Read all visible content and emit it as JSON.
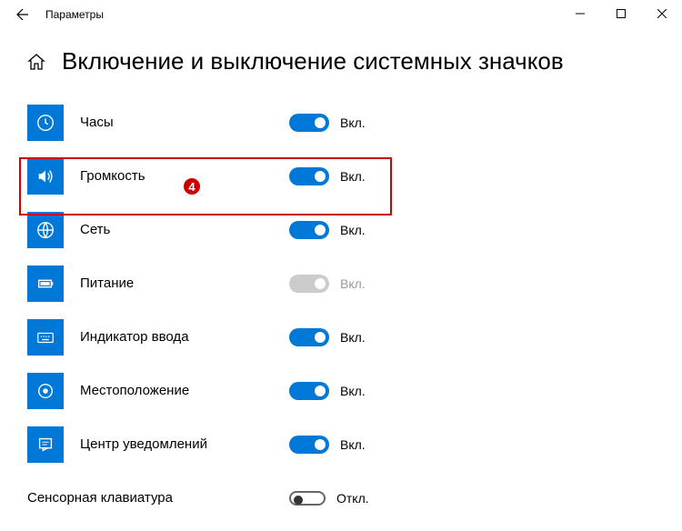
{
  "window": {
    "title": "Параметры"
  },
  "page": {
    "title": "Включение и выключение системных значков"
  },
  "labels": {
    "on": "Вкл.",
    "off": "Откл."
  },
  "callout": {
    "number": "4"
  },
  "items": [
    {
      "label": "Часы",
      "state": "on",
      "disabled": false
    },
    {
      "label": "Громкость",
      "state": "on",
      "disabled": false
    },
    {
      "label": "Сеть",
      "state": "on",
      "disabled": false
    },
    {
      "label": "Питание",
      "state": "on",
      "disabled": true
    },
    {
      "label": "Индикатор ввода",
      "state": "on",
      "disabled": false
    },
    {
      "label": "Местоположение",
      "state": "on",
      "disabled": false
    },
    {
      "label": "Центр уведомлений",
      "state": "on",
      "disabled": false
    },
    {
      "label": "Сенсорная клавиатура",
      "state": "off",
      "disabled": false
    }
  ]
}
